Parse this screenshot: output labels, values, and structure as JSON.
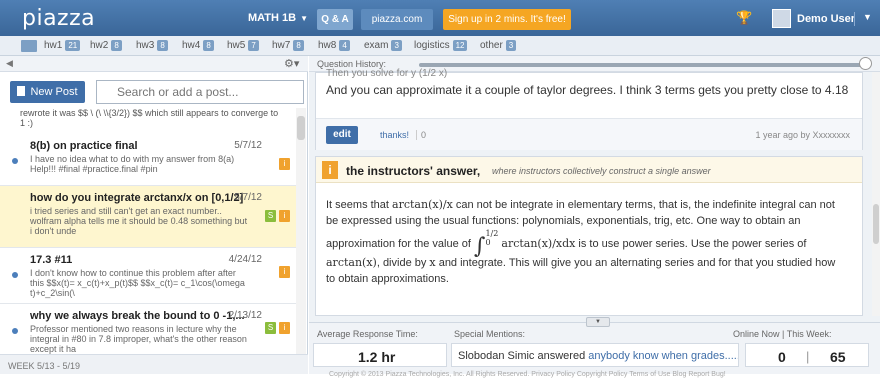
{
  "header": {
    "logo": "piazza",
    "course": "MATH 1B",
    "nav_qa": "Q & A",
    "nav_site": "piazza.com",
    "nav_signup": "Sign up in 2 mins. It's free!",
    "user_name": "Demo User"
  },
  "folders": [
    {
      "label": "hw1",
      "count": "21"
    },
    {
      "label": "hw2",
      "count": "8"
    },
    {
      "label": "hw3",
      "count": "8"
    },
    {
      "label": "hw4",
      "count": "8"
    },
    {
      "label": "hw5",
      "count": "7"
    },
    {
      "label": "hw7",
      "count": "8"
    },
    {
      "label": "hw8",
      "count": "4"
    },
    {
      "label": "exam",
      "count": "3"
    },
    {
      "label": "logistics",
      "count": "12"
    },
    {
      "label": "other",
      "count": "3"
    }
  ],
  "sidebar": {
    "new_post": "New Post",
    "search_placeholder": "Search or add a post...",
    "partial_snippet": "rewrote it was $$ \\ (\\ \\\\{3/2}) $$ which still appears to converge to 1 :)",
    "items": [
      {
        "title": "8(b) on practice final",
        "date": "5/7/12",
        "body": "I have no idea what to do with my answer from 8(a) Help!!! #final #practice.final #pin",
        "badges": [
          "i"
        ]
      },
      {
        "title": "how do you integrate arctanx/x on [0,1/2]",
        "date": "5/7/12",
        "body": "i tried series and still can't get an exact number.. wolfram alpha tells me it should be 0.48 something but i don't unde",
        "badges": [
          "S",
          "i"
        ]
      },
      {
        "title": "17.3 #11",
        "date": "4/24/12",
        "body": "I don't know how to continue this problem after after this $$x(t)= x_c(t)+x_p(t)$$ $$x_c(t)= c_1\\cos(\\omega t)+c_2\\sin(\\",
        "badges": [
          "i"
        ]
      },
      {
        "title": "why we always break the bound to 0 -1,...",
        "date": "2/13/12",
        "body": "Professor mentioned two reasons in lecture why the integral in #80 in 7.8 improper, what's the other reason except it ha",
        "badges": [
          "S",
          "i"
        ]
      }
    ],
    "week_label": "WEEK 5/13 - 5/19"
  },
  "main": {
    "history_label": "Question History:",
    "partial_top": "Then you solve for y (1/2 x)",
    "student_answer": "And you can approximate it a couple of taylor degrees. I think 3 terms gets you pretty close to 4.18",
    "edit": "edit",
    "thanks": "thanks!",
    "thanks_count": "0",
    "ago": "1 year ago by Xxxxxxxx",
    "instructor_badge": "i",
    "instructor_title": "the instructors' answer,",
    "instructor_sub": "where instructors collectively construct a single answer",
    "answer_p1a": "It seems that ",
    "answer_p1_math": "arctan(x)/x",
    "answer_p1b": " can not be integrate in elementary terms, that is, the indefinite integral can not be expressed using the usual functions: polynomials, exponentials, trig, etc. One way to obtain an approximation for the value of ",
    "integral_upper": "1/2",
    "integral_lower": "0",
    "integral_expr": "arctan(x)/xdx",
    "answer_p2a": " is to use power series. Use the power series of ",
    "answer_p2_math": "arctan(x)",
    "answer_p2b": ", divide by ",
    "answer_p2_x": "x",
    "answer_p2c": " and integrate. This will give you an alternating series and for that you studied how to obtain approximations."
  },
  "stats": {
    "avg_label": "Average Response Time:",
    "avg_value": "1.2 hr",
    "mentions_label": "Special Mentions:",
    "mention_text": "Slobodan Simic answered ",
    "mention_link": "anybody know when grades......",
    "online_label": "Online Now  |  This Week:",
    "online_now": "0",
    "this_week": "65",
    "footer": "Copyright © 2013 Piazza Technologies, Inc. All Rights Reserved. Privacy Policy Copyright Policy Terms of Use Blog Report Bug!"
  }
}
